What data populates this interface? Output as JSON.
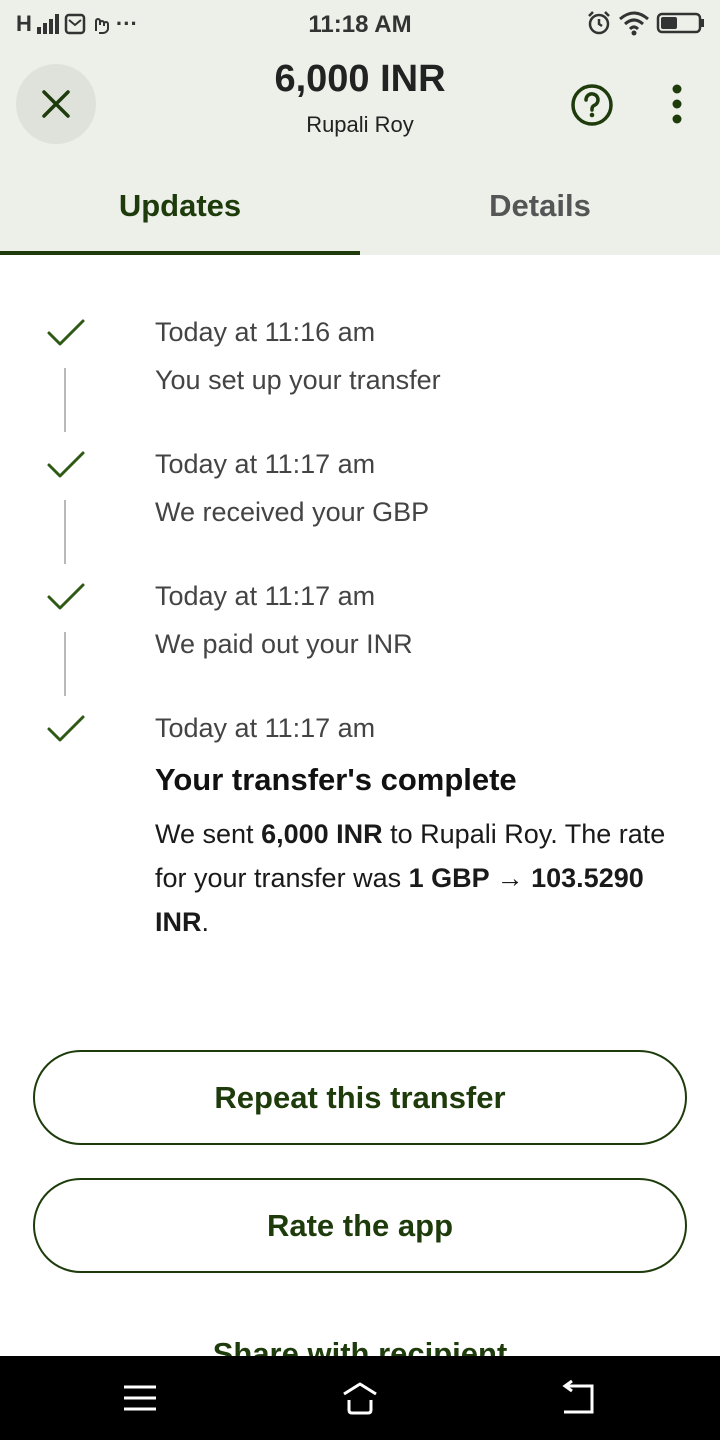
{
  "status_bar": {
    "network": "H",
    "time": "11:18 AM",
    "more_indicator": "···"
  },
  "header": {
    "amount": "6,000 INR",
    "recipient": "Rupali Roy",
    "close_icon": "close-icon",
    "help_icon": "help-circle-icon",
    "more_icon": "more-vertical-icon"
  },
  "tabs": [
    {
      "label": "Updates",
      "active": true
    },
    {
      "label": "Details",
      "active": false
    }
  ],
  "timeline": [
    {
      "time": "Today at 11:16 am",
      "text": "You set up your transfer"
    },
    {
      "time": "Today at 11:17 am",
      "text": "We received your GBP"
    },
    {
      "time": "Today at 11:17 am",
      "text": "We paid out your INR"
    },
    {
      "time": "Today at 11:17 am",
      "title": "Your transfer's complete"
    }
  ],
  "complete_message": {
    "prefix": "We sent ",
    "amount": "6,000 INR",
    "middle": " to Rupali Roy. The rate for your transfer was ",
    "rate": "1 GBP → 103.5290 INR",
    "suffix": "."
  },
  "actions": {
    "repeat": "Repeat this transfer",
    "rate": "Rate the app",
    "share": "Share with recipient"
  },
  "colors": {
    "accent": "#1d3b0b",
    "header_bg": "#edefe9",
    "check": "#2f5a14"
  }
}
